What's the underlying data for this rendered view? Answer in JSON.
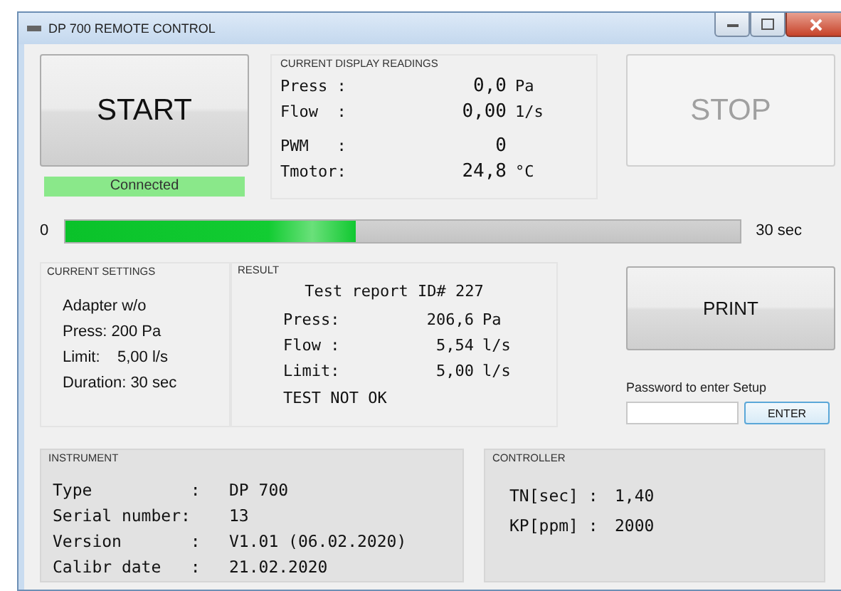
{
  "window": {
    "title": "DP 700 REMOTE CONTROL"
  },
  "start_button": {
    "label": "START"
  },
  "connection_status": {
    "label": "Connected",
    "connected": true
  },
  "current_display_readings": {
    "title": "CURRENT DISPLAY READINGS",
    "rows": [
      {
        "label": "Press :",
        "value": "0,0",
        "unit": "Pa"
      },
      {
        "label": "Flow  :",
        "value": "0,00",
        "unit": "1/s"
      },
      {
        "label": "PWM   :",
        "value": "0",
        "unit": ""
      },
      {
        "label": "Tmotor:",
        "value": "24,8",
        "unit": "°C"
      }
    ]
  },
  "stop_button": {
    "label": "STOP",
    "disabled": true
  },
  "progress": {
    "min_label": "0",
    "max_label": "30 sec",
    "level": 0.43
  },
  "current_settings": {
    "title": "CURRENT SETTINGS",
    "lines": [
      "Adapter w/o",
      "Press: 200 Pa",
      "Limit:    5,00 l/s",
      "Duration: 30 sec"
    ]
  },
  "result": {
    "title": "RESULT",
    "heading": "Test report ID# 227",
    "rows": [
      {
        "label": "Press:",
        "value": "206,6",
        "unit": "Pa"
      },
      {
        "label": "Flow :",
        "value": "5,54",
        "unit": "l/s"
      },
      {
        "label": "Limit:",
        "value": "5,00",
        "unit": "l/s"
      }
    ],
    "verdict": "TEST NOT OK"
  },
  "print_button": {
    "label": "PRINT"
  },
  "setup": {
    "label": "Password to enter Setup",
    "button": "ENTER"
  },
  "instrument": {
    "title": "INSTRUMENT",
    "rows": [
      {
        "label": "Type          :",
        "value": "DP 700"
      },
      {
        "label": "Serial number:",
        "value": "13"
      },
      {
        "label": "Version       :",
        "value": "V1.01 (06.02.2020)"
      },
      {
        "label": "Calibr date   :",
        "value": "21.02.2020"
      }
    ]
  },
  "controller": {
    "title": "CONTROLLER",
    "rows": [
      {
        "label": "TN[sec] :",
        "value": "1,40"
      },
      {
        "label": "KP[ppm] :",
        "value": "2000"
      }
    ]
  }
}
